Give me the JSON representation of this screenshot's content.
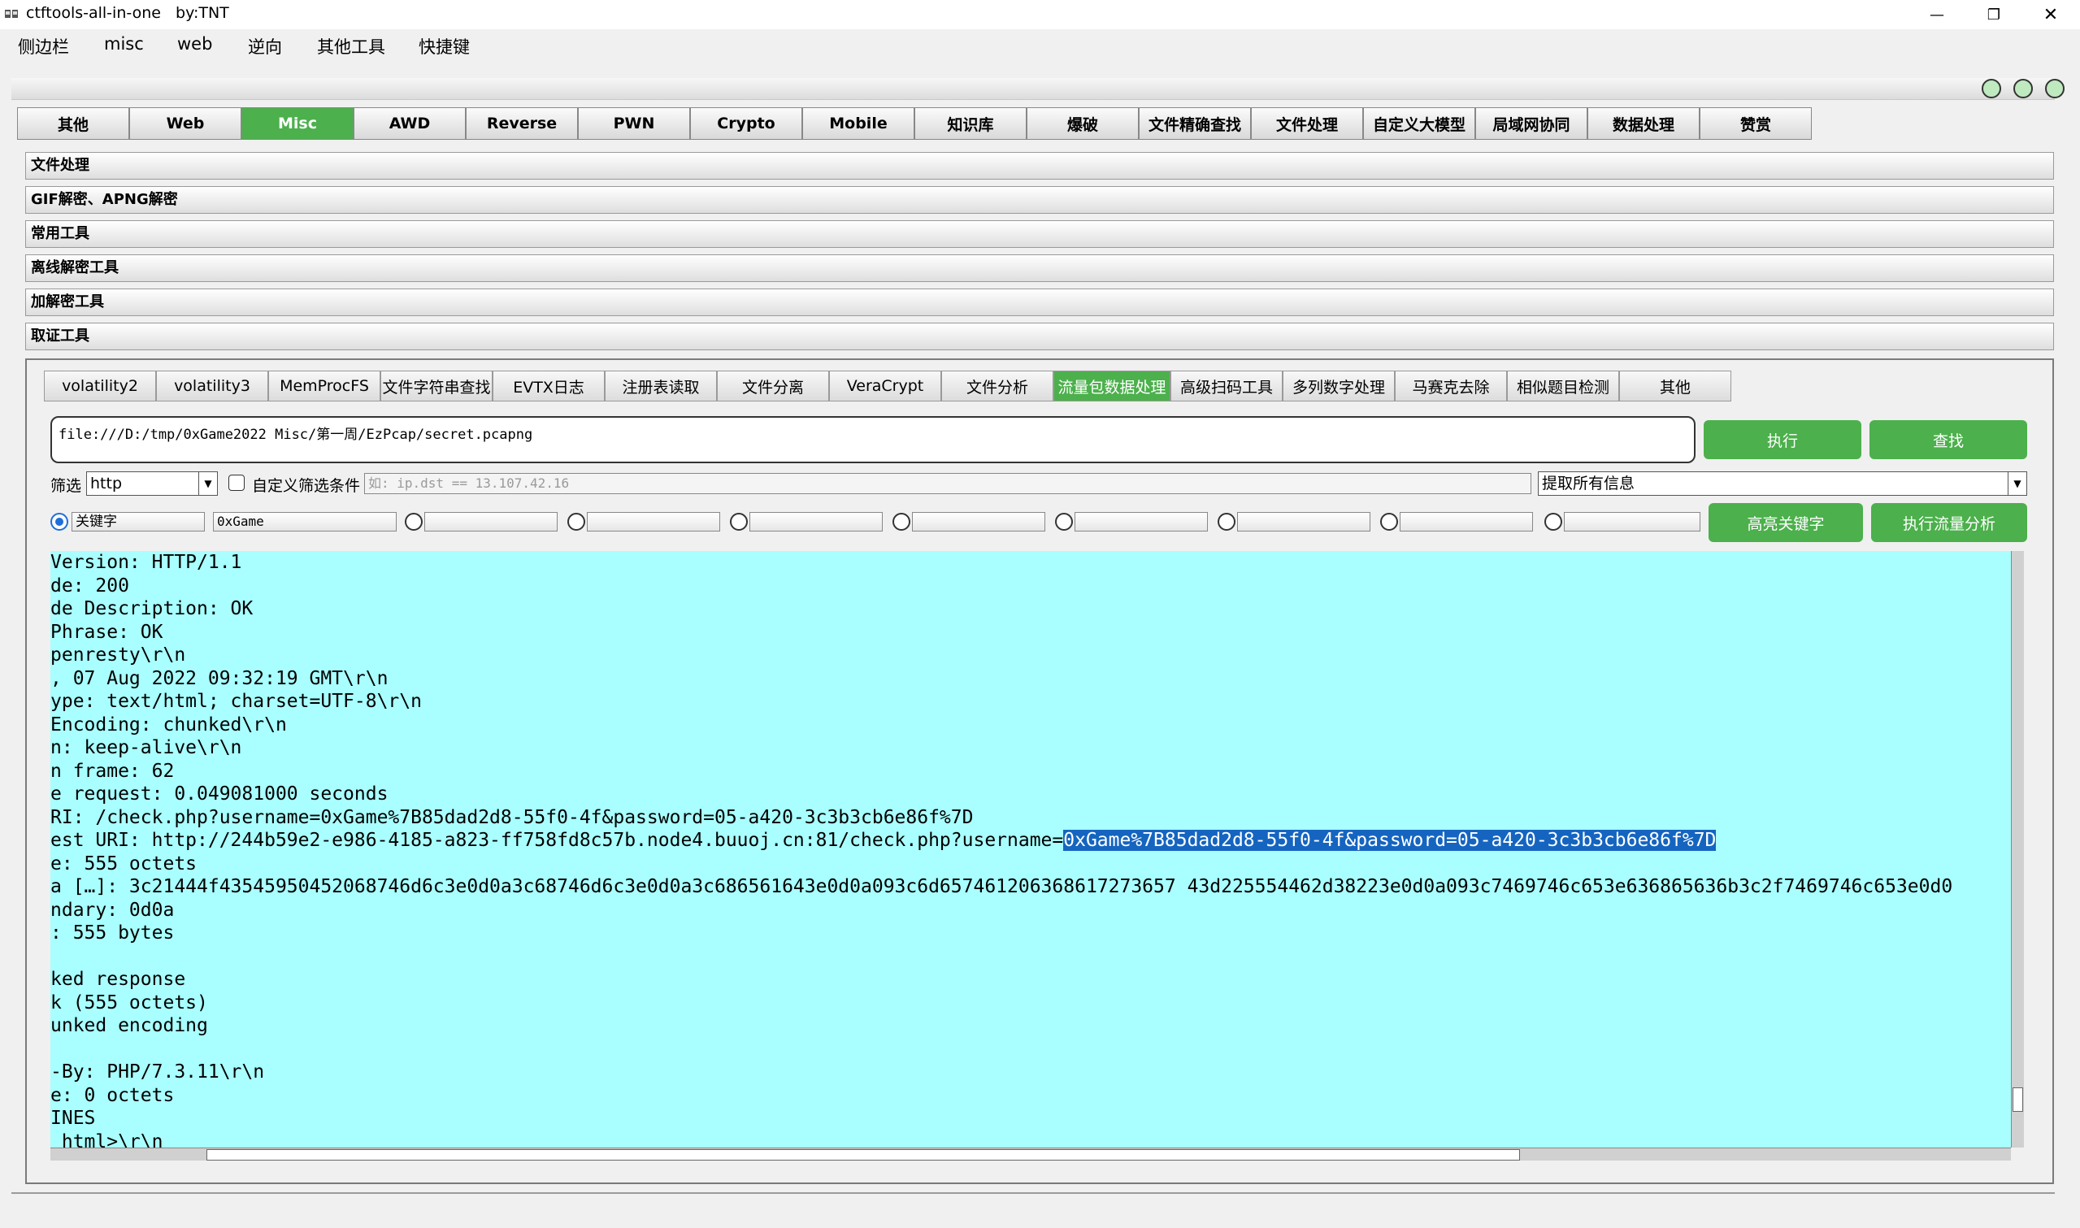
{
  "window": {
    "title": "ctftools-all-in-one   by:TNT",
    "minimize_symbol": "—",
    "restore_symbol": "❐",
    "close_symbol": "✕"
  },
  "menubar": [
    "侧边栏",
    "misc",
    "web",
    "逆向",
    "其他工具",
    "快捷键"
  ],
  "main_tabs": [
    {
      "label": "其他",
      "active": false
    },
    {
      "label": "Web",
      "active": false
    },
    {
      "label": "Misc",
      "active": true
    },
    {
      "label": "AWD",
      "active": false
    },
    {
      "label": "Reverse",
      "active": false
    },
    {
      "label": "PWN",
      "active": false
    },
    {
      "label": "Crypto",
      "active": false
    },
    {
      "label": "Mobile",
      "active": false
    },
    {
      "label": "知识库",
      "active": false
    },
    {
      "label": "爆破",
      "active": false
    },
    {
      "label": "文件精确查找",
      "active": false
    },
    {
      "label": "文件处理",
      "active": false
    },
    {
      "label": "自定义大模型",
      "active": false
    },
    {
      "label": "局域网协同",
      "active": false
    },
    {
      "label": "数据处理",
      "active": false
    },
    {
      "label": "赞赏",
      "active": false
    }
  ],
  "sections": [
    "文件处理",
    "GIF解密、APNG解密",
    "常用工具",
    "离线解密工具",
    "加解密工具",
    "取证工具"
  ],
  "sub_tabs": [
    {
      "label": "volatility2",
      "active": false
    },
    {
      "label": "volatility3",
      "active": false
    },
    {
      "label": "MemProcFS",
      "active": false
    },
    {
      "label": "文件字符串查找",
      "active": false
    },
    {
      "label": "EVTX日志",
      "active": false
    },
    {
      "label": "注册表读取",
      "active": false
    },
    {
      "label": "文件分离",
      "active": false
    },
    {
      "label": "VeraCrypt",
      "active": false
    },
    {
      "label": "文件分析",
      "active": false
    },
    {
      "label": "流量包数据处理",
      "active": true
    },
    {
      "label": "高级扫码工具",
      "active": false
    },
    {
      "label": "多列数字处理",
      "active": false
    },
    {
      "label": "马赛克去除",
      "active": false
    },
    {
      "label": "相似题目检测",
      "active": false
    },
    {
      "label": "其他",
      "active": false
    }
  ],
  "traffic": {
    "path": "file:///D:/tmp/0xGame2022 Misc/第一周/EzPcap/secret.pcapng",
    "execute_label": "执行",
    "search_label": "查找",
    "filter_label": "筛选",
    "filter_value": "http",
    "custom_filter_label": "自定义筛选条件",
    "custom_filter_checked": false,
    "filter_placeholder": "如: ip.dst == 13.107.42.16",
    "extract_value": "提取所有信息",
    "keyword_label": "关键字",
    "keyword_value": "0xGame",
    "highlight_label": "高亮关键字",
    "analyze_label": "执行流量分析"
  },
  "output": {
    "lines": [
      "Version: HTTP/1.1",
      "de: 200",
      "de Description: OK",
      "Phrase: OK",
      "penresty\\r\\n",
      ", 07 Aug 2022 09:32:19 GMT\\r\\n",
      "ype: text/html; charset=UTF-8\\r\\n",
      "Encoding: chunked\\r\\n",
      "n: keep-alive\\r\\n",
      "n frame: 62",
      "e request: 0.049081000 seconds",
      "RI: /check.php?username=0xGame%7B85dad2d8-55f0-4f&password=05-a420-3c3b3cb6e86f%7D",
      "",
      "e: 555 octets",
      "a […]: 3c21444f43545950452068746d6c3e0d0a3c68746d6c3e0d0a3c686561643e0d0a093c6d657461206368617273657 43d225554462d38223e0d0a093c7469746c653e636865636b3c2f7469746c653e0d0",
      "ndary: 0d0a",
      ": 555 bytes",
      "",
      "ked response",
      "k (555 octets)",
      "unked encoding",
      "",
      "-By: PHP/7.3.11\\r\\n",
      "e: 0 octets",
      "INES",
      " html>\\r\\n"
    ],
    "highlight_line_prefix": "est URI: http://244b59e2-e986-4185-a823-ff758fd8c57b.node4.buuoj.cn:81/check.php?username=",
    "highlight_text": "0xGame%7B85dad2d8-55f0-4f&password=05-a420-3c3b3cb6e86f%7D"
  },
  "colors": {
    "accent_green": "#4cb04c",
    "output_bg": "#a9ffff",
    "highlight_bg": "#1565c0"
  }
}
